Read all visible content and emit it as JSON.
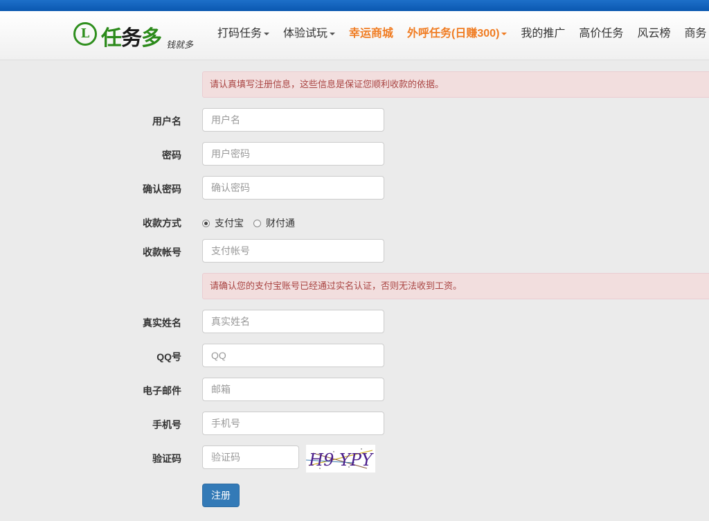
{
  "header": {
    "logo_mark": "L",
    "logo_name_part1": "任",
    "logo_name_part2": "务",
    "logo_name_part3": "多",
    "logo_slogan": "钱就多",
    "nav": [
      {
        "label": "打码任务",
        "dropdown": true,
        "highlight": false
      },
      {
        "label": "体验试玩",
        "dropdown": true,
        "highlight": false
      },
      {
        "label": "幸运商城",
        "dropdown": false,
        "highlight": true
      },
      {
        "label": "外呼任务(日赚300)",
        "dropdown": true,
        "highlight": true
      },
      {
        "label": "我的推广",
        "dropdown": false,
        "highlight": false
      },
      {
        "label": "高价任务",
        "dropdown": false,
        "highlight": false
      },
      {
        "label": "风云榜",
        "dropdown": false,
        "highlight": false
      },
      {
        "label": "商务",
        "dropdown": false,
        "highlight": false
      }
    ],
    "colors": {
      "top_bar": "#0a58b0",
      "highlight": "#f07c22",
      "logo_green": "#2b8a1a"
    }
  },
  "form": {
    "notice_top": "请认真填写注册信息，这些信息是保证您顺利收款的依据。",
    "username": {
      "label": "用户名",
      "placeholder": "用户名",
      "value": ""
    },
    "password": {
      "label": "密码",
      "placeholder": "用户密码",
      "value": ""
    },
    "confirm_password": {
      "label": "确认密码",
      "placeholder": "确认密码",
      "value": ""
    },
    "payment_method": {
      "label": "收款方式",
      "options": [
        "支付宝",
        "财付通"
      ],
      "selected": "支付宝"
    },
    "payment_account": {
      "label": "收款帐号",
      "placeholder": "支付帐号",
      "value": ""
    },
    "notice_alipay": "请确认您的支付宝账号已经通过实名认证，否则无法收到工资。",
    "real_name": {
      "label": "真实姓名",
      "placeholder": "真实姓名",
      "value": ""
    },
    "qq": {
      "label": "QQ号",
      "placeholder": "QQ",
      "value": ""
    },
    "email": {
      "label": "电子邮件",
      "placeholder": "邮箱",
      "value": ""
    },
    "phone": {
      "label": "手机号",
      "placeholder": "手机号",
      "value": ""
    },
    "captcha": {
      "label": "验证码",
      "placeholder": "验证码",
      "value": "",
      "image_text": "H9 YPY"
    },
    "submit_label": "注册",
    "colors": {
      "alert_bg": "#f2dede",
      "alert_text": "#a94442",
      "button": "#337ab7"
    }
  }
}
